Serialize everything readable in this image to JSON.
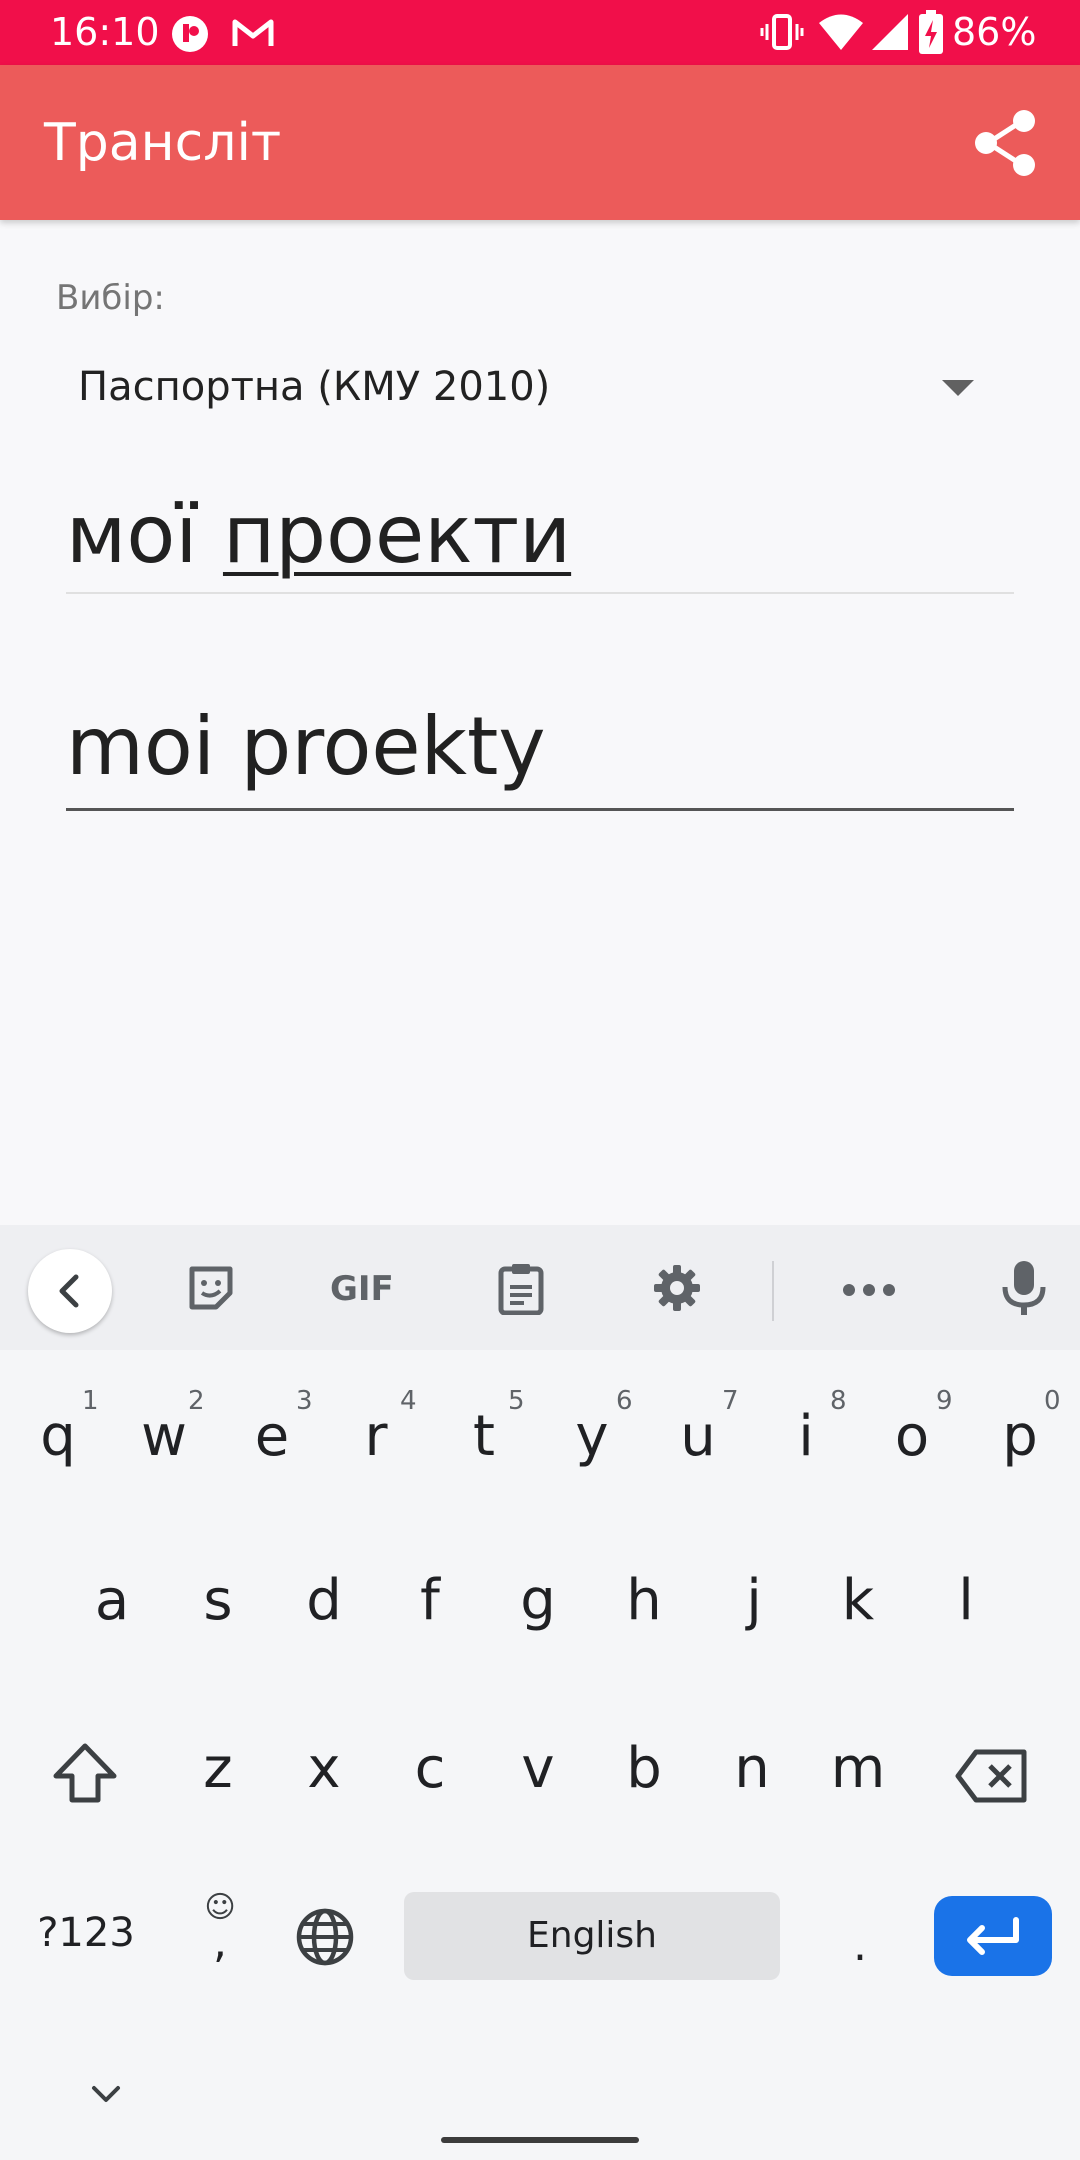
{
  "status_bar": {
    "time": "16:10",
    "battery": "86%"
  },
  "app_bar": {
    "title": "Трансліт",
    "share_icon": "share-icon"
  },
  "form": {
    "selector_label": "Вибір:",
    "selector_value": "Паспортна (КМУ 2010)",
    "input_plain": "мої ",
    "input_underlined": "проекти",
    "output_text": "moi proekty"
  },
  "keyboard": {
    "row1": [
      {
        "key": "q",
        "hint": "1"
      },
      {
        "key": "w",
        "hint": "2"
      },
      {
        "key": "e",
        "hint": "3"
      },
      {
        "key": "r",
        "hint": "4"
      },
      {
        "key": "t",
        "hint": "5"
      },
      {
        "key": "y",
        "hint": "6"
      },
      {
        "key": "u",
        "hint": "7"
      },
      {
        "key": "i",
        "hint": "8"
      },
      {
        "key": "o",
        "hint": "9"
      },
      {
        "key": "p",
        "hint": "0"
      }
    ],
    "row2": [
      "a",
      "s",
      "d",
      "f",
      "g",
      "h",
      "j",
      "k",
      "l"
    ],
    "row3": [
      "z",
      "x",
      "c",
      "v",
      "b",
      "n",
      "m"
    ],
    "symbols_key": "?123",
    "comma_key": ",",
    "period_key": ".",
    "space_label": "English",
    "toolbar_gif": "GIF"
  },
  "colors": {
    "status_bar": "#f10f4a",
    "app_bar": "#ec5b5a",
    "enter_key": "#1a73e8"
  }
}
